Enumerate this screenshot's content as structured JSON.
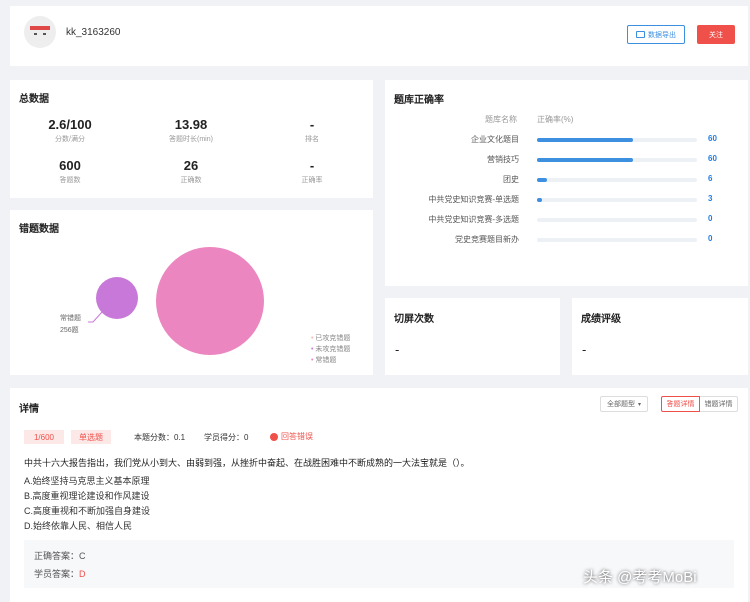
{
  "profile": {
    "username": "kk_3163260",
    "export_label": "数据导出",
    "follow_label": "关注"
  },
  "summary": {
    "title": "总数据",
    "stats": [
      {
        "value": "2.6/100",
        "label": "分数/满分"
      },
      {
        "value": "13.98",
        "label": "答题时长(min)"
      },
      {
        "value": "-",
        "label": "排名"
      },
      {
        "value": "600",
        "label": "答题数"
      },
      {
        "value": "26",
        "label": "正确数"
      },
      {
        "value": "-",
        "label": "正确率"
      }
    ]
  },
  "accuracy": {
    "title": "题库正确率",
    "header_name": "题库名称",
    "header_rate": "正确率(%)",
    "rows": [
      {
        "name": "企业文化题目",
        "value": "60"
      },
      {
        "name": "营销技巧",
        "value": "60"
      },
      {
        "name": "团史",
        "value": "6"
      },
      {
        "name": "中共党史知识竞赛-单选题",
        "value": "3"
      },
      {
        "name": "中共党史知识竞赛-多选题",
        "value": "0"
      },
      {
        "name": "党史竞赛题目新办",
        "value": "0"
      }
    ]
  },
  "errors": {
    "title": "错题数据",
    "bubble_label": "常错题",
    "bubble_count": "256题",
    "legend": [
      "已攻克错题",
      "未攻克错题",
      "常错题"
    ],
    "colors": {
      "small": "#c878d8",
      "large": "#ec86c0"
    }
  },
  "switch_screen": {
    "title": "切屏次数",
    "value": "-"
  },
  "grade": {
    "title": "成绩评级",
    "value": "-"
  },
  "detail": {
    "title": "详情",
    "filter": "全部题型",
    "tab_answer": "答题详情",
    "tab_wrong": "错题详情",
    "index": "1/600",
    "type": "单选题",
    "score_label": "本题分数：0.1",
    "student_score": "学员得分：0",
    "status": "回答错误",
    "question": "中共十六大报告指出，我们党从小到大、由弱到强，从挫折中奋起、在战胜困难中不断成熟的一大法宝就是（）。",
    "options": [
      "A.始终坚持马克思主义基本原理",
      "B.高度重视理论建设和作风建设",
      "C.高度重视和不断加强自身建设",
      "D.始终依靠人民、相信人民"
    ],
    "correct_label": "正确答案：",
    "correct": "C",
    "student_label": "学员答案：",
    "student": "D"
  },
  "watermark": "头条 @考考MoBi",
  "theme": {
    "accent": "#3d8fe0",
    "danger": "#f0504a",
    "tag_bg": "#fde8e8"
  }
}
